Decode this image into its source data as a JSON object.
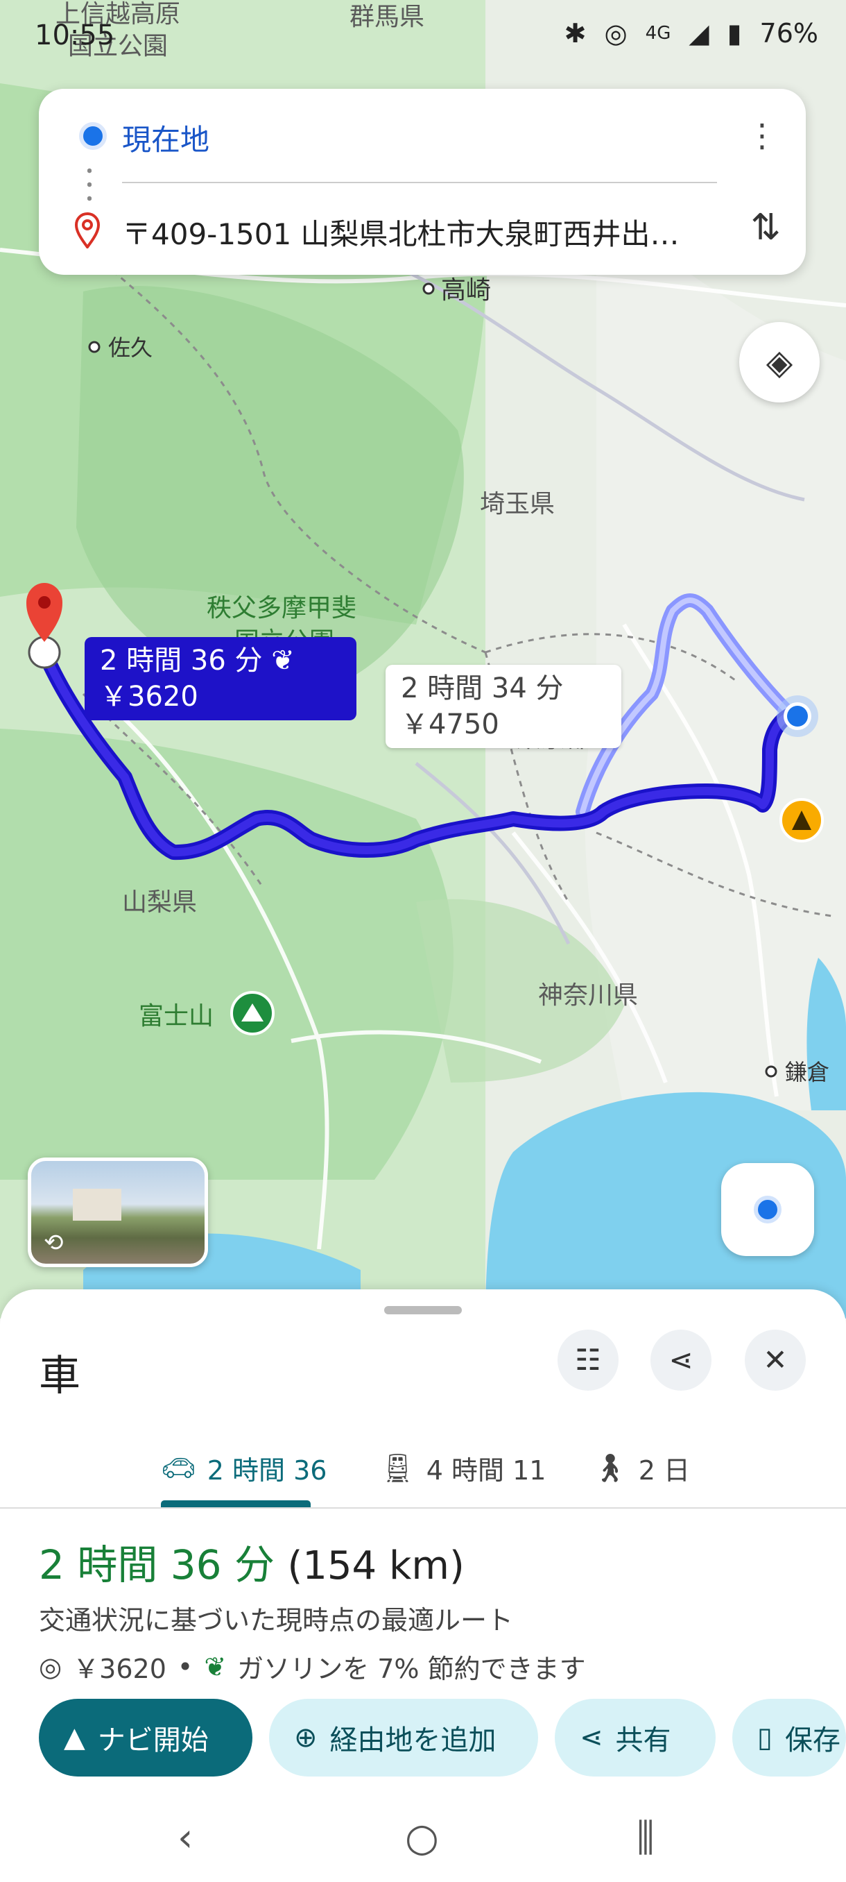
{
  "status_bar": {
    "time": "10:55",
    "battery": "76%",
    "network": "4G"
  },
  "search": {
    "origin": "現在地",
    "destination": "〒409-1501 山梨県北杜市大泉町西井出…"
  },
  "map": {
    "place_labels": {
      "kozuke": "上信越高原",
      "kozuke2": "国立公園",
      "gunma": "群馬県",
      "takasaki": "高崎",
      "saku": "佐久",
      "saitama": "埼玉県",
      "chichibu": "秩父多摩甲斐",
      "chichibu2": "国立公園",
      "tokyo": "東京都",
      "yamanashi": "山梨県",
      "fuji": "富士山",
      "kanagawa": "神奈川県",
      "kamakura": "鎌倉"
    },
    "routes": {
      "main_time": "2 時間 36 分",
      "main_toll": "￥3620",
      "alt_time": "2 時間 34 分",
      "alt_toll": "￥4750"
    },
    "icons": {
      "layers": "layers-icon",
      "construction": "construction-icon",
      "mountain": "mountain-icon"
    }
  },
  "sheet": {
    "mode_title": "車",
    "tabs": [
      {
        "label": "2 時間 36",
        "icon": "car-icon",
        "active": true
      },
      {
        "label": "4 時間 11",
        "icon": "train-icon",
        "active": false
      },
      {
        "label": "2 日",
        "icon": "walk-icon",
        "active": false
      }
    ],
    "summary_time": "2 時間 36 分",
    "summary_distance": "(154 km)",
    "summary_desc": "交通状況に基づいた現時点の最適ルート",
    "toll": "￥3620",
    "fuel_saving": "ガソリンを 7% 節約できます",
    "actions": {
      "start": "ナビ開始",
      "add_stop": "経由地を追加",
      "share": "共有",
      "save": "保存"
    }
  },
  "colors": {
    "route_main": "#2a14d4",
    "route_alt": "#7d8bff",
    "accent_teal": "#0b6b7a",
    "eco_green": "#188038"
  }
}
